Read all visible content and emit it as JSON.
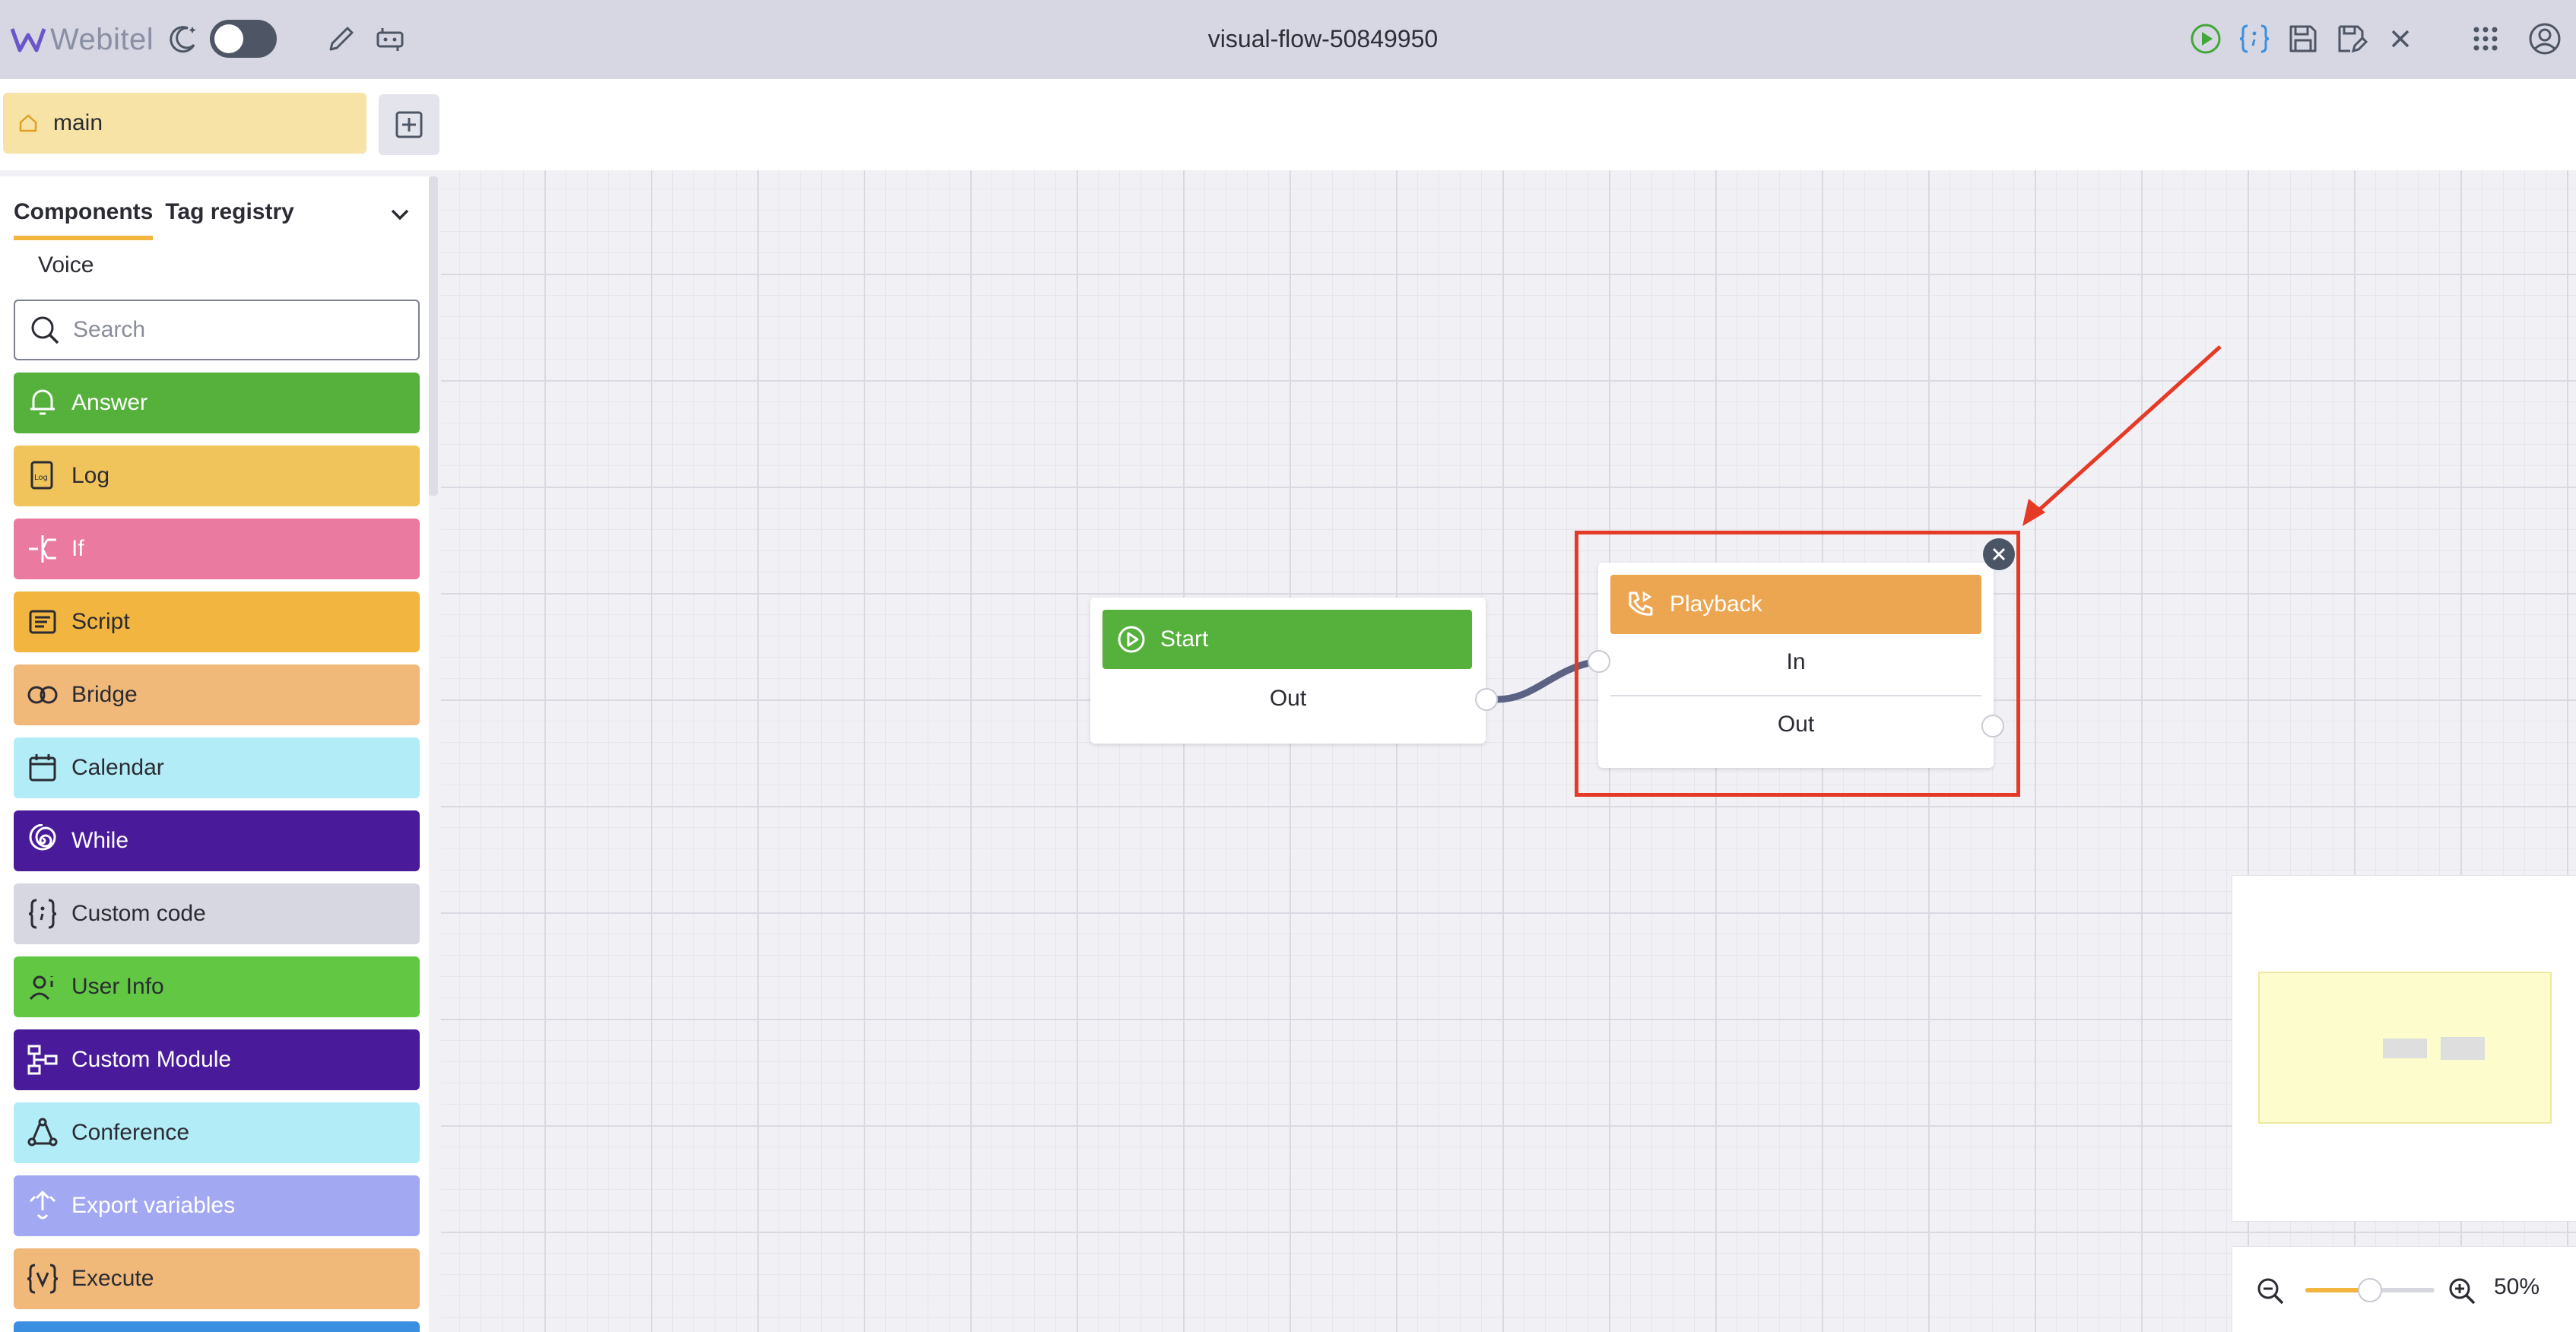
{
  "header": {
    "logo_text": "Webitel",
    "flow_title": "visual-flow-50849950"
  },
  "tabs": {
    "main_label": "main"
  },
  "panel": {
    "tab_components": "Components",
    "tab_tag_registry": "Tag registry",
    "group_label": "Voice",
    "search_placeholder": "Search",
    "components": [
      {
        "label": "Answer",
        "bg": "#55b13c",
        "fg": "#ffffff",
        "icon": "bell-icon"
      },
      {
        "label": "Log",
        "bg": "#f0c45a",
        "fg": "#2b2b33",
        "icon": "log-icon"
      },
      {
        "label": "If",
        "bg": "#eb7aa0",
        "fg": "#ffffff",
        "icon": "branch-icon"
      },
      {
        "label": "Script",
        "bg": "#f2b640",
        "fg": "#2b2b33",
        "icon": "script-icon"
      },
      {
        "label": "Bridge",
        "bg": "#f0b97a",
        "fg": "#2b2b33",
        "icon": "bridge-icon"
      },
      {
        "label": "Calendar",
        "bg": "#b2ecf6",
        "fg": "#2b2b33",
        "icon": "calendar-icon"
      },
      {
        "label": "While",
        "bg": "#491b9a",
        "fg": "#ffffff",
        "icon": "spiral-icon"
      },
      {
        "label": "Custom code",
        "bg": "#d6d7e0",
        "fg": "#2b2b33",
        "icon": "braces-icon"
      },
      {
        "label": "User Info",
        "bg": "#62c843",
        "fg": "#2b2b33",
        "icon": "user-info-icon"
      },
      {
        "label": "Custom Module",
        "bg": "#491b9a",
        "fg": "#ffffff",
        "icon": "module-icon"
      },
      {
        "label": "Conference",
        "bg": "#b2ecf6",
        "fg": "#2b2b33",
        "icon": "conference-icon"
      },
      {
        "label": "Export variables",
        "bg": "#a3a8f3",
        "fg": "#ffffff",
        "icon": "export-icon"
      },
      {
        "label": "Execute",
        "bg": "#f0b97a",
        "fg": "#2b2b33",
        "icon": "execute-icon"
      }
    ]
  },
  "nodes": {
    "start": {
      "title": "Start",
      "out": "Out",
      "color": "#55b13c"
    },
    "playback": {
      "title": "Playback",
      "in": "In",
      "out": "Out",
      "color": "#eca550"
    }
  },
  "zoom": {
    "label": "50%",
    "level": 0.5
  },
  "colors": {
    "accent": "#f2b640",
    "highlight": "#e53a26"
  }
}
